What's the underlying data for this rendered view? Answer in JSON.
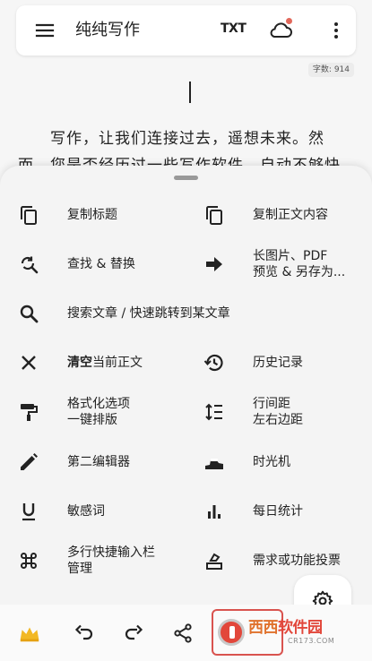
{
  "appbar": {
    "title": "纯纯写作",
    "txt_label": "TXT"
  },
  "editor": {
    "word_count": "字数: 914",
    "text": "写作，让我们连接过去，遥想未来。然而，您是否经历过一些写作软件，自动不够快"
  },
  "sheet": {
    "items": [
      {
        "label": "复制标题",
        "icon": "copy-icon"
      },
      {
        "label": "复制正文内容",
        "icon": "copy-icon"
      },
      {
        "label": "查找 & 替换",
        "icon": "find-replace-icon"
      },
      {
        "label": "长图片、PDF\n预览 & 另存为...",
        "icon": "arrow-right-icon"
      },
      {
        "label": "搜索文章 / 快速跳转到某文章",
        "icon": "search-icon"
      },
      {
        "label_bold": "清空",
        "label_rest": "当前正文",
        "icon": "close-icon"
      },
      {
        "label": "历史记录",
        "icon": "history-icon"
      },
      {
        "label": "格式化选项\n一键排版",
        "icon": "format-paint-icon"
      },
      {
        "label": "行间距\n左右边距",
        "icon": "line-spacing-icon"
      },
      {
        "label": "第二编辑器",
        "icon": "edit-icon"
      },
      {
        "label": "时光机",
        "icon": "time-machine-icon"
      },
      {
        "label": "敏感词",
        "icon": "underline-icon"
      },
      {
        "label": "每日统计",
        "icon": "bar-chart-icon"
      },
      {
        "label": "多行快捷输入栏\n管理",
        "icon": "command-icon"
      },
      {
        "label": "需求或功能投票",
        "icon": "vote-icon"
      }
    ]
  },
  "watermark": {
    "brand_a": "西西",
    "brand_b": "软件园",
    "site": "CR173.COM"
  },
  "colors": {
    "accent_red": "#e2473b",
    "dot": "#e2685b",
    "crown": "#f2b824"
  }
}
